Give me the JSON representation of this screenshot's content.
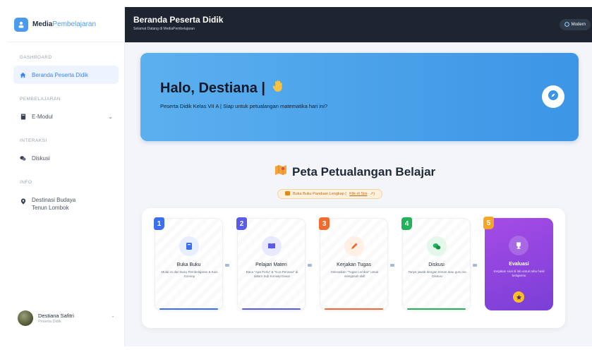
{
  "brand": {
    "name_bold": "Media",
    "name_accent": "Pembelajaran"
  },
  "sidebar": {
    "sections": {
      "dashboard": "DASHBOARD",
      "pembelajaran": "PEMBELAJARAN",
      "interaksi": "INTERAKSI",
      "info": "INFO"
    },
    "items": {
      "beranda": "Beranda Peserta Didik",
      "emodul": "E-Modul",
      "diskusi": "Diskusi",
      "destinasi_line1": "Destinasi Budaya",
      "destinasi_line2": "Tenun Lombok"
    }
  },
  "user": {
    "name": "Destiana Safitri",
    "role": "Peserta Didik"
  },
  "header": {
    "title": "Beranda Peserta Didik",
    "subtitle": "Selamat Datang di MediaPembelajaran",
    "mode_button": "Modern"
  },
  "hero": {
    "greeting": "Halo, Destiana |",
    "subtitle": "Peserta Didik Kelas VII A | Siap untuk petualangan matematika hari ini?"
  },
  "map": {
    "title": "Peta Petualangan Belajar",
    "book_prefix": "Buka Buku Panduan Lengkap (",
    "book_link": "Klik di Sini",
    "book_suffix": "↗)"
  },
  "steps": [
    {
      "number": "1",
      "name": "Buka Buku",
      "desc": "Mulai ini dari Buku Pembelajaran & Kuis Konsep",
      "color": "#3b6ff0",
      "icon": "book-icon"
    },
    {
      "number": "2",
      "name": "Pelajari Materi",
      "desc": "Baca \"Apa Perlu\" & \"Kon-Pensasi\" di dalam Sub Konsep Dasar",
      "color": "#5a5be6",
      "icon": "open-book-icon"
    },
    {
      "number": "3",
      "name": "Kerjakan Tugas",
      "desc": "Selesaikan \"Tugas Lembar\" untuk mengasah skill",
      "color": "#f06b2e",
      "icon": "pencil-icon"
    },
    {
      "number": "4",
      "name": "Diskusi",
      "desc": "Tanya jawab dengan teman atau guru via Diskusi",
      "color": "#22b25a",
      "icon": "chat-icon"
    },
    {
      "number": "5",
      "name": "Evaluasi",
      "desc": "Kerjakan soal di lab untuk tahu hasil belajarmu",
      "color": "#f5a623",
      "icon": "trophy-icon"
    }
  ],
  "colors": {
    "accent": "#4a9bf0",
    "header_bg": "#1e2530",
    "hero_start": "#5bb0ee",
    "hero_end": "#3c95e6"
  }
}
